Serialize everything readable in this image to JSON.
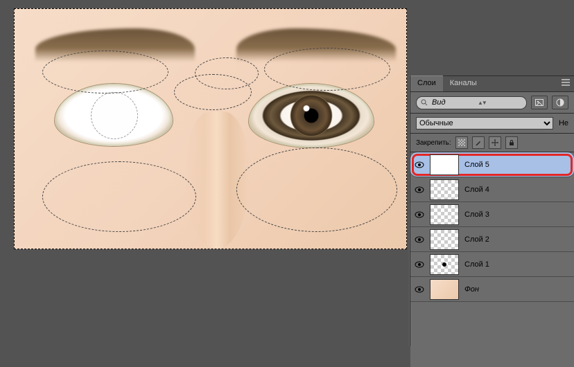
{
  "tabs": {
    "layers": "Слои",
    "channels": "Каналы"
  },
  "filter": {
    "placeholder": "Вид"
  },
  "blend": {
    "mode": "Обычные",
    "opacity_lbl_fragment": "Не"
  },
  "lock": {
    "label": "Закрепить:"
  },
  "layers": [
    {
      "name": "Слой 5",
      "thumb": "white",
      "selected": true,
      "highlighted": true,
      "italic": false
    },
    {
      "name": "Слой 4",
      "thumb": "checker",
      "selected": false,
      "highlighted": false,
      "italic": false
    },
    {
      "name": "Слой 3",
      "thumb": "checker",
      "selected": false,
      "highlighted": false,
      "italic": false
    },
    {
      "name": "Слой 2",
      "thumb": "checker",
      "selected": false,
      "highlighted": false,
      "italic": false
    },
    {
      "name": "Слой 1",
      "thumb": "dot",
      "selected": false,
      "highlighted": false,
      "italic": false
    },
    {
      "name": "Фон",
      "thumb": "face",
      "selected": false,
      "highlighted": false,
      "italic": true
    }
  ]
}
